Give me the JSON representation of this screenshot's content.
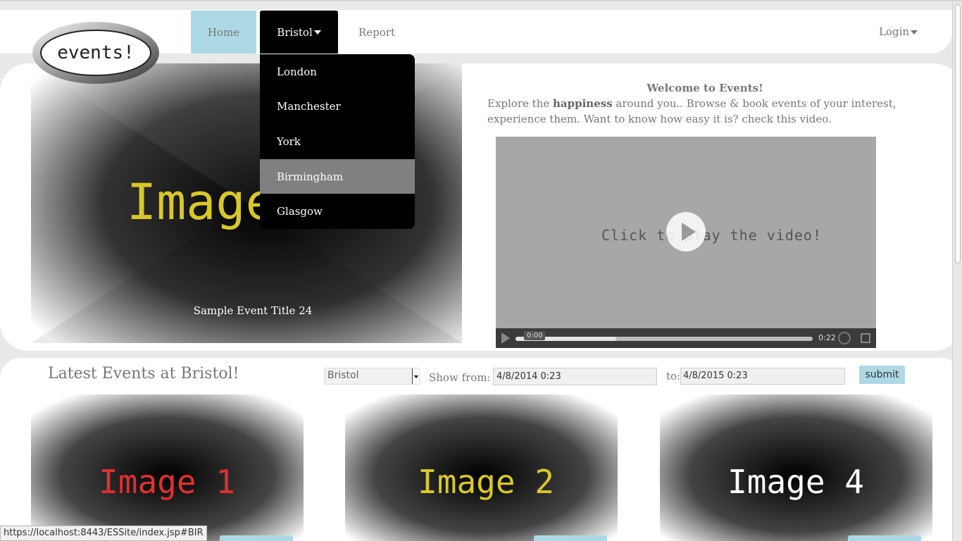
{
  "header": {
    "logo_text": "events!",
    "nav": {
      "home": "Home",
      "bristol": "Bristol",
      "report": "Report"
    },
    "login": "Login"
  },
  "dropdown": {
    "items": [
      {
        "label": "London"
      },
      {
        "label": "Manchester"
      },
      {
        "label": "York"
      },
      {
        "label": "Birmingham",
        "active": true
      },
      {
        "label": "Glasgow"
      }
    ]
  },
  "hero": {
    "image_text": "Image",
    "caption": "Sample Event Title 24"
  },
  "welcome": {
    "title": "Welcome to Events!",
    "text_prefix": "Explore the ",
    "text_bold": "happiness",
    "text_suffix": " around you.. Browse & book events of your interest, experience them. Want to know how easy it is? check this video."
  },
  "video": {
    "overlay_text": "Click to play the video!",
    "current_time": "0:00",
    "duration": "0:22",
    "buffered_fraction": 0.34
  },
  "events": {
    "title": "Latest Events at Bristol!",
    "city_select": "Bristol",
    "show_from_label": "Show from:",
    "from_value": "4/8/2014 0:23",
    "to_label": "to:",
    "to_value": "4/8/2015 0:23",
    "submit_label": "submit",
    "cards": [
      {
        "label": "Image 1",
        "color": "#e03030"
      },
      {
        "label": "Image 2",
        "color": "#d8c828"
      },
      {
        "label": "Image 4",
        "color": "#ffffff"
      }
    ]
  },
  "status_url": "https://localhost:8443/ESSite/index.jsp#BIR",
  "colors": {
    "accent": "#add8e6",
    "hero_text": "#d8c828"
  }
}
